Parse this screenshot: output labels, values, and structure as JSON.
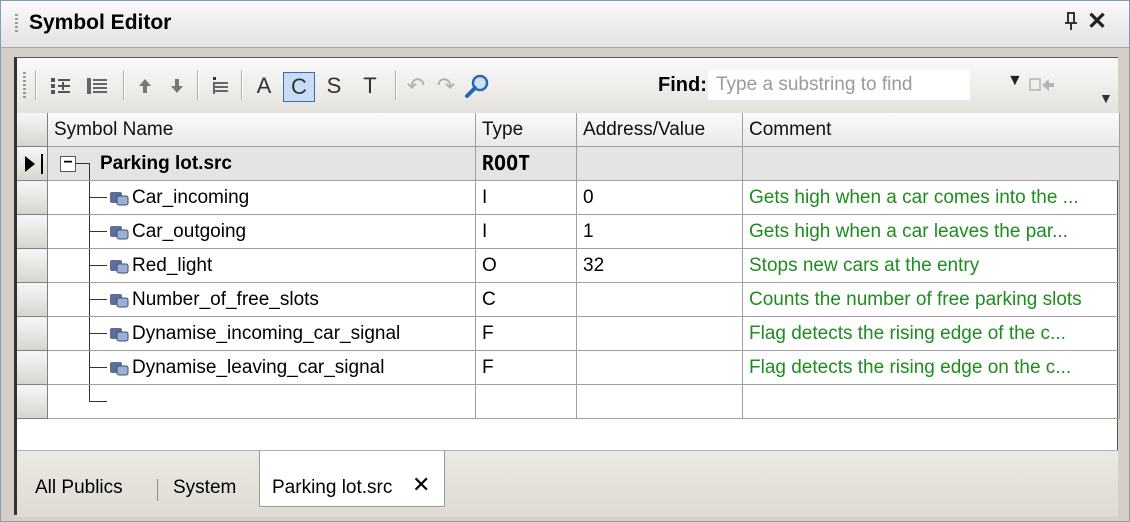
{
  "window": {
    "title": "Symbol Editor",
    "pin_glyph": "ѱ",
    "close_glyph": "✕"
  },
  "toolbar": {
    "buttons": [
      {
        "name": "columns-icon",
        "glyph": ""
      },
      {
        "name": "list-icon",
        "glyph": ""
      },
      {
        "name": "move-up-icon",
        "glyph": "↑"
      },
      {
        "name": "move-down-icon",
        "glyph": "↓"
      },
      {
        "name": "insert-row-icon",
        "glyph": ""
      },
      {
        "name": "filter-a",
        "label": "A"
      },
      {
        "name": "filter-c",
        "label": "C",
        "active": true
      },
      {
        "name": "filter-s",
        "label": "S"
      },
      {
        "name": "filter-t",
        "label": "T"
      },
      {
        "name": "undo-icon",
        "glyph": "↶"
      },
      {
        "name": "redo-icon",
        "glyph": "↷"
      }
    ],
    "find_label": "Find:",
    "find_placeholder": "Type a substring to find",
    "find_value": ""
  },
  "columns": {
    "name": "Symbol Name",
    "type": "Type",
    "address": "Address/Value",
    "comment": "Comment"
  },
  "root": {
    "name": "Parking lot.src",
    "type": "ROOT",
    "address": "",
    "comment": ""
  },
  "symbols": [
    {
      "name": "Car_incoming",
      "type": "I",
      "address": "0",
      "comment": "Gets high when a car comes into the ..."
    },
    {
      "name": "Car_outgoing",
      "type": "I",
      "address": "1",
      "comment": "Gets high when a car leaves the par..."
    },
    {
      "name": "Red_light",
      "type": "O",
      "address": "32",
      "comment": "Stops new cars at the entry"
    },
    {
      "name": "Number_of_free_slots",
      "type": "C",
      "address": "",
      "comment": "Counts the number of free parking slots"
    },
    {
      "name": "Dynamise_incoming_car_signal",
      "type": "F",
      "address": "",
      "comment": "Flag detects the rising edge of the  c..."
    },
    {
      "name": "Dynamise_leaving_car_signal",
      "type": "F",
      "address": "",
      "comment": "Flag detects the rising edge on the c..."
    }
  ],
  "tabs": {
    "all_publics": "All Publics",
    "system": "System",
    "parking": "Parking lot.src",
    "close_glyph": "✕"
  },
  "colors": {
    "comment_text": "#1e8c1e",
    "active_filter_bg": "#c9dcf5",
    "active_filter_border": "#3c6cb4"
  }
}
